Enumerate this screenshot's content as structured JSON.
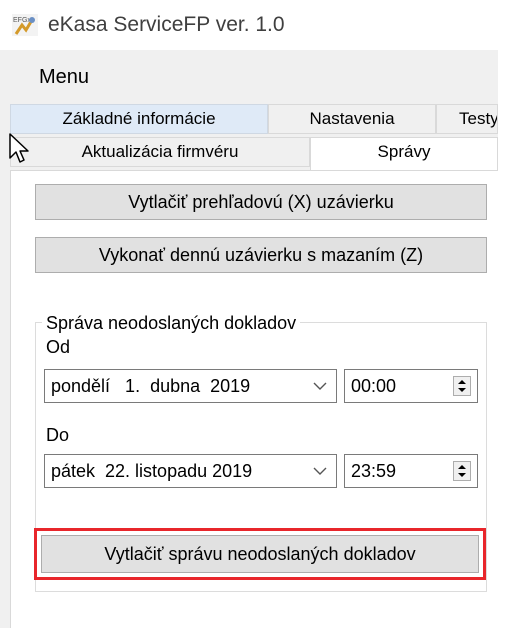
{
  "window": {
    "title": "eKasa ServiceFP ver. 1.0",
    "icon": "app-icon"
  },
  "menu": {
    "items": [
      "Menu"
    ]
  },
  "tabs": {
    "row1": [
      "Základné informácie",
      "Nastavenia",
      "Testy"
    ],
    "row2": [
      "Aktualizácia firmvéru",
      "Správy"
    ],
    "selected": "Správy",
    "hovered": "Základné informácie"
  },
  "buttons": {
    "print_x": "Vytlačiť prehľadovú (X) uzávierku",
    "daily_z": "Vykonať dennú uzávierku s mazaním (Z)",
    "print_unsent": "Vytlačiť správu neodoslaných dokladov"
  },
  "unsent_group": {
    "title": "Správa neodoslaných dokladov",
    "from_label": "Od",
    "from_date": "pondělí   1.  dubna  2019",
    "from_time": "00:00",
    "to_label": "Do",
    "to_date": "pátek  22. listopadu 2019",
    "to_time": "23:59"
  },
  "colors": {
    "highlight_frame": "#e8262b",
    "hover_tab": "#dfeaf7"
  }
}
